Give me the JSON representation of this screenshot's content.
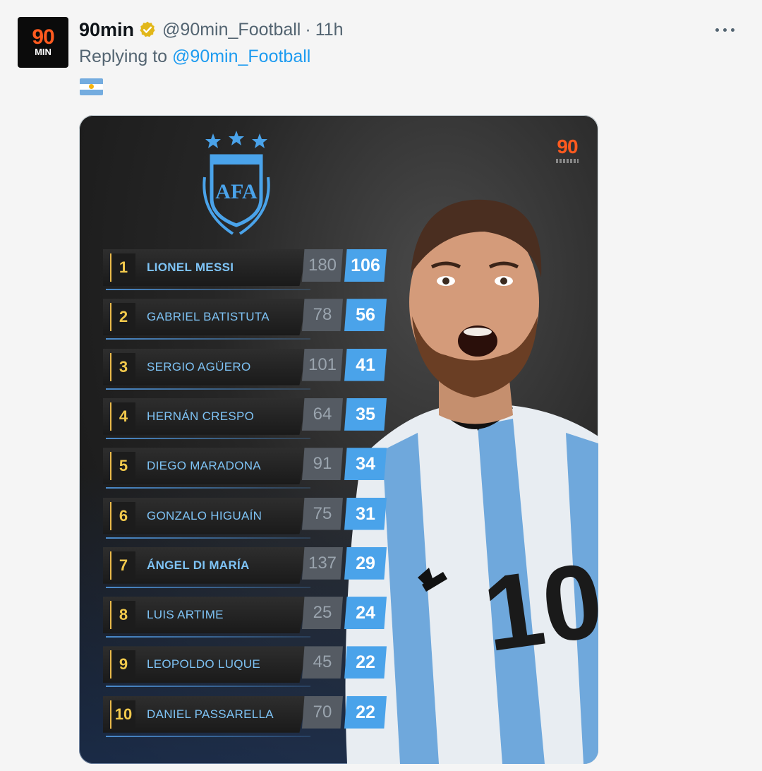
{
  "tweet": {
    "avatar_text_top": "90",
    "avatar_text_bottom": "MIN",
    "author_name": "90min",
    "handle": "@90min_Football",
    "separator": "·",
    "time": "11h",
    "reply_prefix": "Replying to ",
    "reply_handle": "@90min_Football",
    "verified_color": "#e2b719",
    "flag": "argentina-flag"
  },
  "graphic": {
    "brand_mark": "90",
    "crest_text": "AFA",
    "accent_blue": "#4aa3ea",
    "rank_gold": "#f2c94c",
    "rankings": [
      {
        "rank": "1",
        "name": "LIONEL MESSI",
        "caps": "180",
        "goals": "106",
        "bold": true
      },
      {
        "rank": "2",
        "name": "GABRIEL BATISTUTA",
        "caps": "78",
        "goals": "56",
        "bold": false
      },
      {
        "rank": "3",
        "name": "SERGIO AGÜERO",
        "caps": "101",
        "goals": "41",
        "bold": false
      },
      {
        "rank": "4",
        "name": "HERNÁN CRESPO",
        "caps": "64",
        "goals": "35",
        "bold": false
      },
      {
        "rank": "5",
        "name": "DIEGO MARADONA",
        "caps": "91",
        "goals": "34",
        "bold": false
      },
      {
        "rank": "6",
        "name": "GONZALO HIGUAÍN",
        "caps": "75",
        "goals": "31",
        "bold": false
      },
      {
        "rank": "7",
        "name": "ÁNGEL DI MARÍA",
        "caps": "137",
        "goals": "29",
        "bold": true
      },
      {
        "rank": "8",
        "name": "LUIS ARTIME",
        "caps": "25",
        "goals": "24",
        "bold": false
      },
      {
        "rank": "9",
        "name": "LEOPOLDO LUQUE",
        "caps": "45",
        "goals": "22",
        "bold": false
      },
      {
        "rank": "10",
        "name": "DANIEL PASSARELLA",
        "caps": "70",
        "goals": "22",
        "bold": false
      }
    ]
  }
}
